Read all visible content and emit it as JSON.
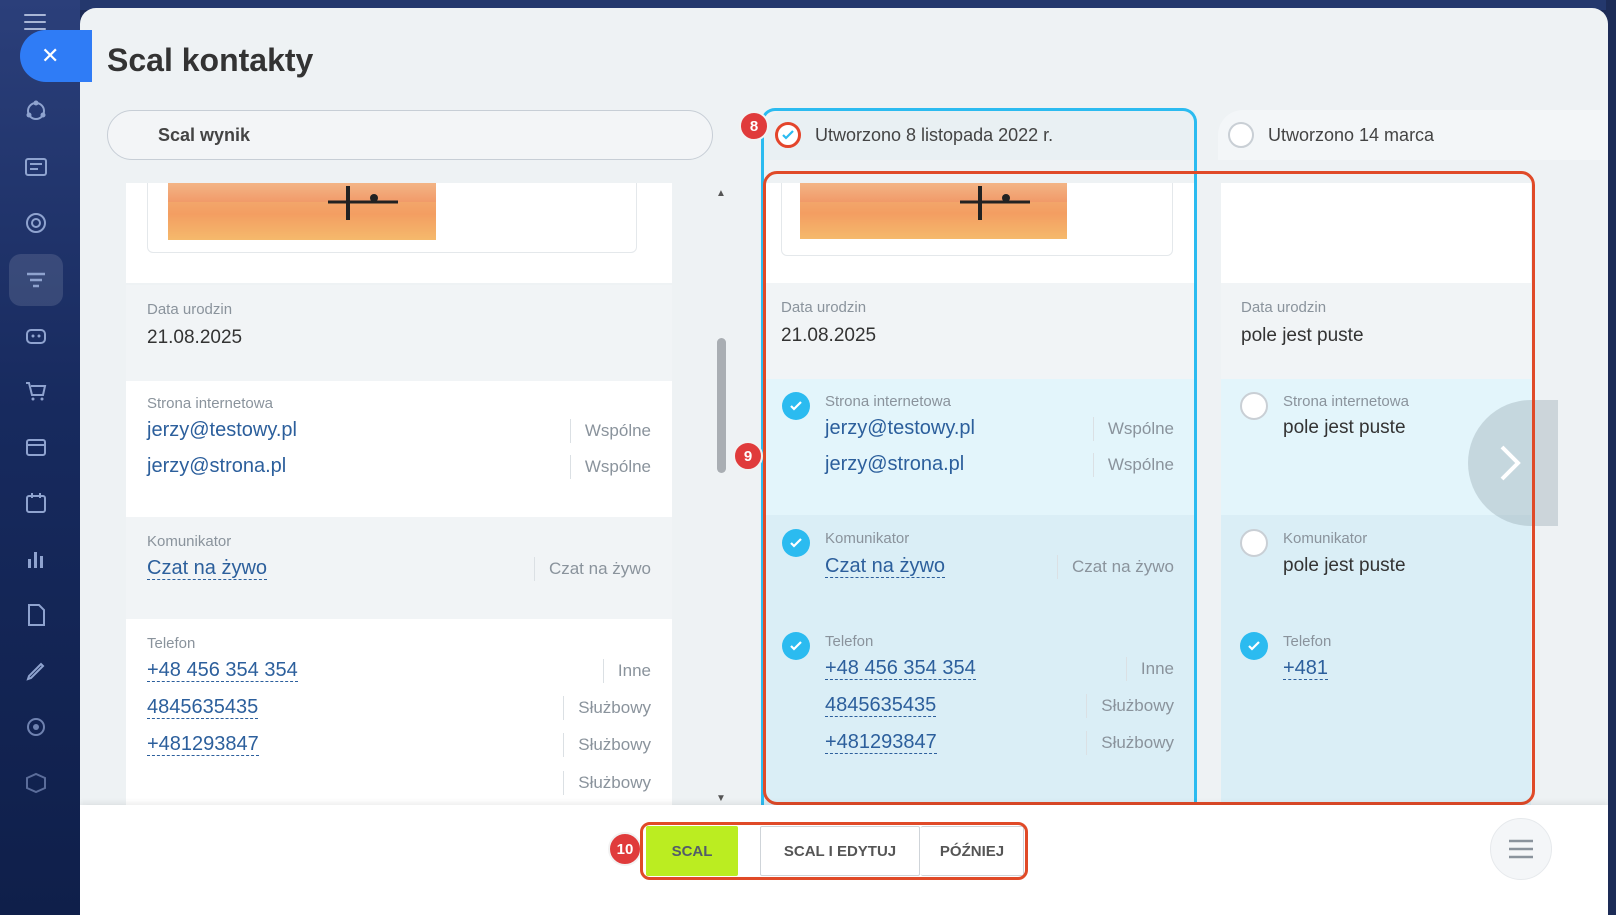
{
  "rail": {
    "icons": [
      "menu-icon",
      "crm-icon",
      "contacts-icon",
      "target-icon",
      "funnel-icon",
      "robot-icon",
      "cart-icon",
      "store-icon",
      "calendar-icon",
      "analytics-icon",
      "document-icon",
      "sign-icon",
      "settings-icon",
      "box-icon"
    ]
  },
  "dialog": {
    "title": "Scal kontakty",
    "result_tab_label": "Scal wynik"
  },
  "result": {
    "birthday": {
      "label": "Data urodzin",
      "value": "21.08.2025"
    },
    "website": {
      "label": "Strona internetowa",
      "items": [
        {
          "value": "jerzy@testowy.pl",
          "type": "Wspólne"
        },
        {
          "value": "jerzy@strona.pl",
          "type": "Wspólne"
        }
      ]
    },
    "messenger": {
      "label": "Komunikator",
      "value": "Czat na żywo",
      "type": "Czat na żywo"
    },
    "phone": {
      "label": "Telefon",
      "items": [
        {
          "value": "+48 456 354 354",
          "type": "Inne"
        },
        {
          "value": "4845635435",
          "type": "Służbowy"
        },
        {
          "value": "+481293847",
          "type": "Służbowy"
        },
        {
          "value": "",
          "type": "Służbowy"
        }
      ]
    }
  },
  "source1": {
    "tab_label": "Utworzono 8 listopada 2022 r.",
    "selected": true,
    "birthday": {
      "label": "Data urodzin",
      "value": "21.08.2025"
    },
    "website": {
      "label": "Strona internetowa",
      "checked": true,
      "items": [
        {
          "value": "jerzy@testowy.pl",
          "type": "Wspólne"
        },
        {
          "value": "jerzy@strona.pl",
          "type": "Wspólne"
        }
      ]
    },
    "messenger": {
      "label": "Komunikator",
      "checked": true,
      "value": "Czat na żywo",
      "type": "Czat na żywo"
    },
    "phone": {
      "label": "Telefon",
      "checked": true,
      "items": [
        {
          "value": "+48 456 354 354",
          "type": "Inne"
        },
        {
          "value": "4845635435",
          "type": "Służbowy"
        },
        {
          "value": "+481293847",
          "type": "Służbowy"
        }
      ]
    }
  },
  "source2": {
    "tab_label": "Utworzono 14 marca",
    "selected": false,
    "birthday": {
      "label": "Data urodzin",
      "value": "pole jest puste"
    },
    "website": {
      "label": "Strona internetowa",
      "checked": false,
      "value": "pole jest puste"
    },
    "messenger": {
      "label": "Komunikator",
      "checked": false,
      "value": "pole jest puste"
    },
    "phone": {
      "label": "Telefon",
      "checked": true,
      "value": "+481"
    }
  },
  "badges": {
    "b8": "8",
    "b9": "9",
    "b10": "10"
  },
  "footer": {
    "merge": "SCAL",
    "merge_edit": "SCAL I EDYTUJ",
    "later": "PÓŹNIEJ"
  },
  "colors": {
    "accent": "#2bbbf0",
    "highlight": "#e04a28",
    "primary_button": "#bbed21"
  }
}
